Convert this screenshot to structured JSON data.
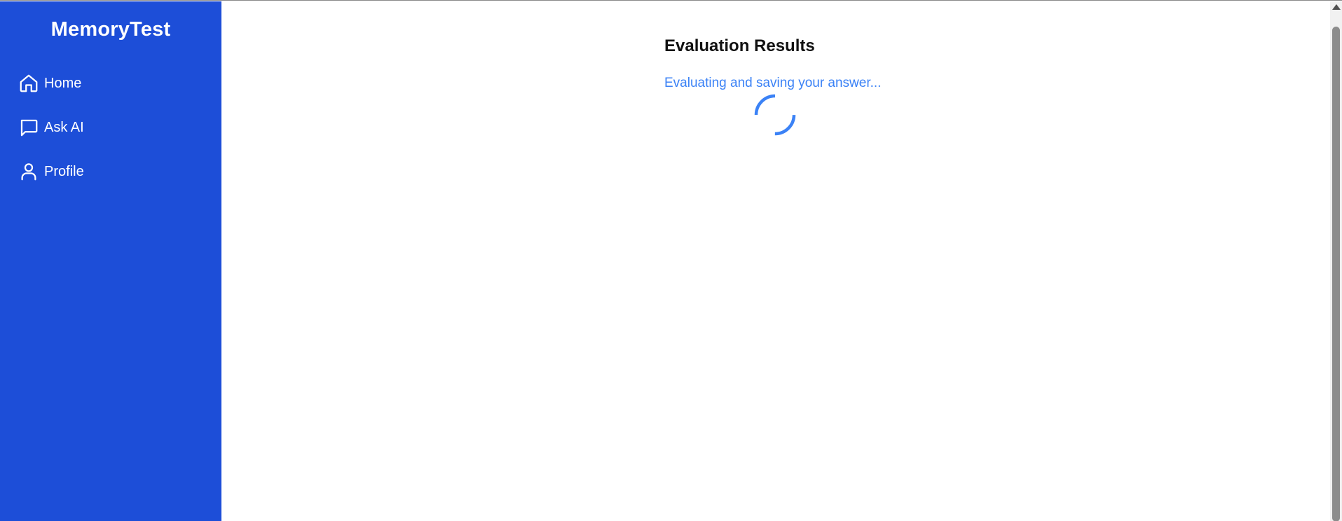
{
  "sidebar": {
    "brand": "MemoryTest",
    "items": [
      {
        "label": "Home",
        "icon": "home-icon"
      },
      {
        "label": "Ask AI",
        "icon": "chat-icon"
      },
      {
        "label": "Profile",
        "icon": "user-icon"
      }
    ]
  },
  "main": {
    "title": "Evaluation Results",
    "status": "Evaluating and saving your answer...",
    "spinner_icon": "loading-spinner-icon"
  },
  "colors": {
    "sidebar_bg": "#1d4ed8",
    "accent": "#3b82f6",
    "text_dark": "#111111"
  }
}
